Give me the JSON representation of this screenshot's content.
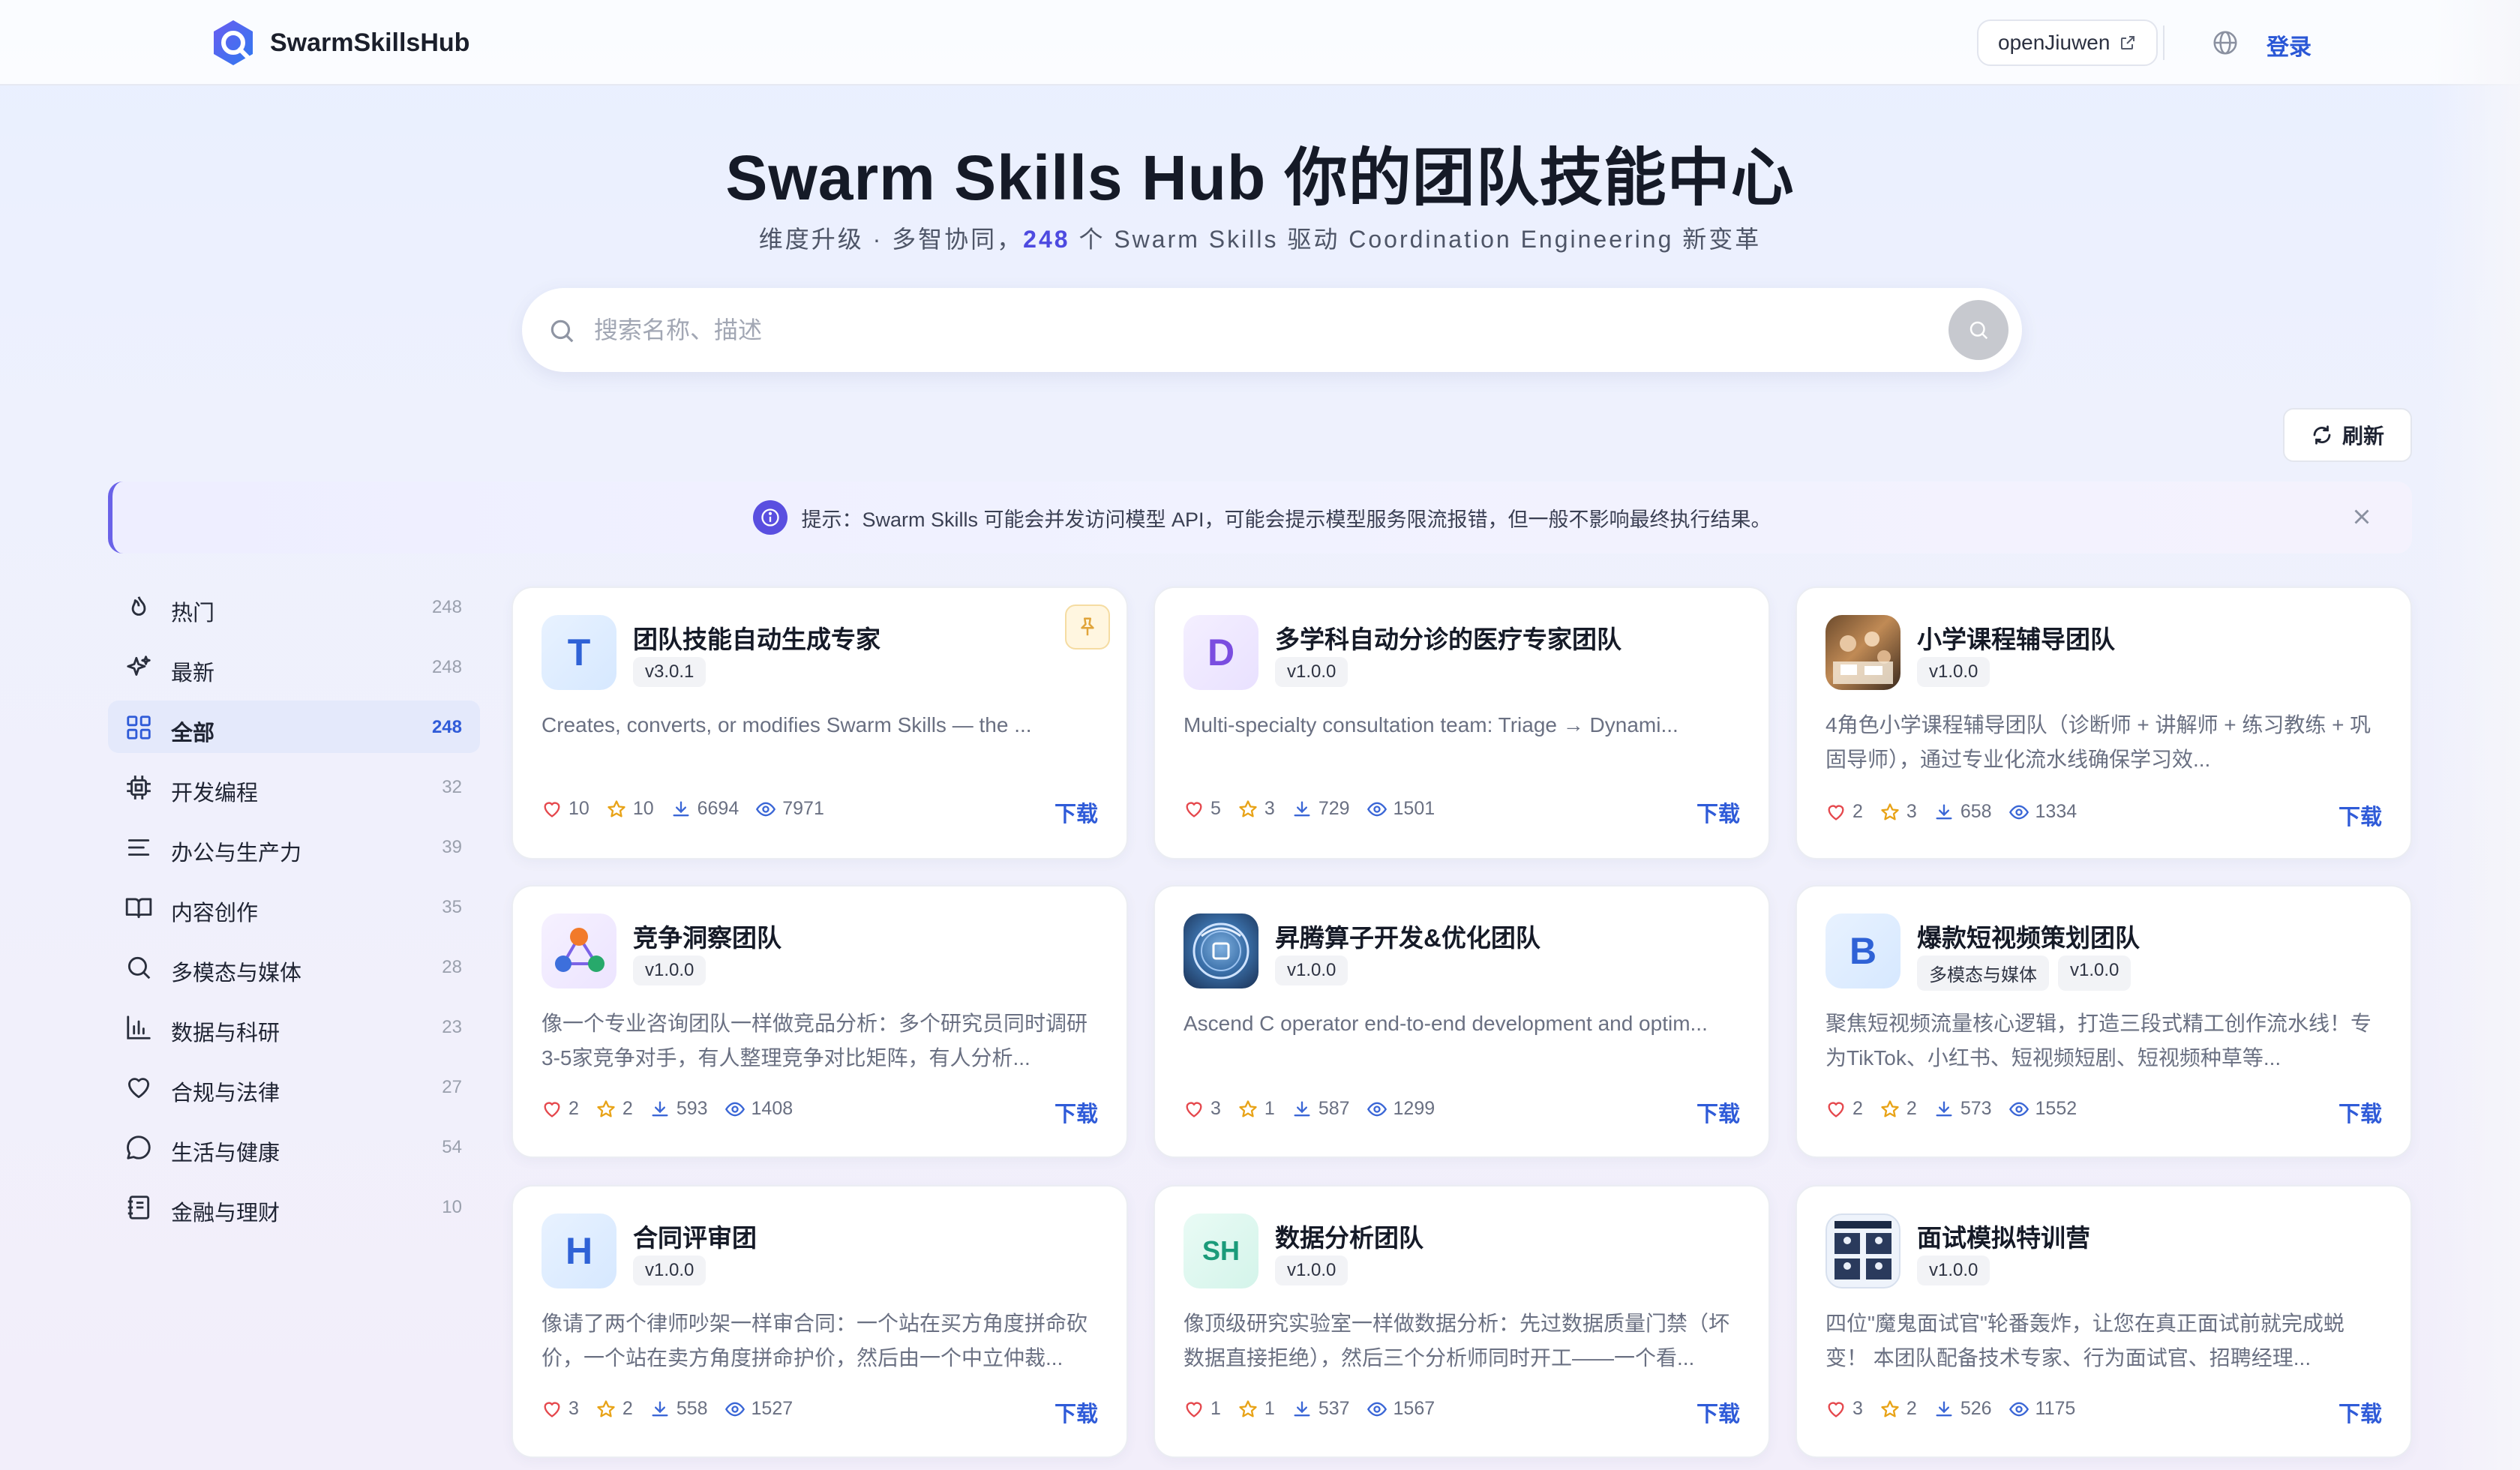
{
  "header": {
    "brand": "SwarmSkillsHub",
    "external_link": "openJiuwen",
    "login": "登录"
  },
  "hero": {
    "title": "Swarm Skills Hub 你的团队技能中心",
    "subtitle_prefix": "维度升级 · 多智协同，",
    "subtitle_count": "248",
    "subtitle_suffix": " 个 Swarm Skills 驱动 Coordination Engineering 新变革"
  },
  "search": {
    "placeholder": "搜索名称、描述"
  },
  "refresh_label": "刷新",
  "notice": {
    "text": "提示：Swarm Skills 可能会并发访问模型 API，可能会提示模型服务限流报错，但一般不影响最终执行结果。"
  },
  "sidebar": {
    "items": [
      {
        "label": "热门",
        "count": "248",
        "icon": "fire-icon"
      },
      {
        "label": "最新",
        "count": "248",
        "icon": "sparkle-icon"
      },
      {
        "label": "全部",
        "count": "248",
        "icon": "grid-icon",
        "active": true
      },
      {
        "label": "开发编程",
        "count": "32",
        "icon": "chip-icon"
      },
      {
        "label": "办公与生产力",
        "count": "39",
        "icon": "lines-icon"
      },
      {
        "label": "内容创作",
        "count": "35",
        "icon": "book-icon"
      },
      {
        "label": "多模态与媒体",
        "count": "28",
        "icon": "search-icon"
      },
      {
        "label": "数据与科研",
        "count": "23",
        "icon": "bar-chart-icon"
      },
      {
        "label": "合规与法律",
        "count": "27",
        "icon": "heart-icon"
      },
      {
        "label": "生活与健康",
        "count": "54",
        "icon": "chat-bubble-icon"
      },
      {
        "label": "金融与理财",
        "count": "10",
        "icon": "ledger-icon"
      }
    ]
  },
  "cards": [
    {
      "avatar": "T",
      "avatar_style": "blue",
      "title": "团队技能自动生成专家",
      "tags": [
        "v3.0.1"
      ],
      "desc": "Creates, converts, or modifies Swarm Skills — the ...",
      "likes": "10",
      "stars": "10",
      "downloads": "6694",
      "views": "7971",
      "pinned": true,
      "download_label": "下载"
    },
    {
      "avatar": "D",
      "avatar_style": "purple",
      "title": "多学科自动分诊的医疗专家团队",
      "tags": [
        "v1.0.0"
      ],
      "desc": "Multi-specialty consultation team: Triage → Dynami...",
      "likes": "5",
      "stars": "3",
      "downloads": "729",
      "views": "1501",
      "download_label": "下载"
    },
    {
      "avatar": "",
      "avatar_style": "photo-classroom",
      "title": "小学课程辅导团队",
      "tags": [
        "v1.0.0"
      ],
      "desc": "4角色小学课程辅导团队（诊断师 + 讲解师 + 练习教练 + 巩固导师），通过专业化流水线确保学习效...",
      "likes": "2",
      "stars": "3",
      "downloads": "658",
      "views": "1334",
      "download_label": "下载"
    },
    {
      "avatar": "",
      "avatar_style": "nodes",
      "title": "竞争洞察团队",
      "tags": [
        "v1.0.0"
      ],
      "desc": "像一个专业咨询团队一样做竞品分析：多个研究员同时调研3-5家竞争对手，有人整理竞争对比矩阵，有人分析...",
      "likes": "2",
      "stars": "2",
      "downloads": "593",
      "views": "1408",
      "download_label": "下载"
    },
    {
      "avatar": "",
      "avatar_style": "cann",
      "title": "昇腾算子开发&优化团队",
      "tags": [
        "v1.0.0"
      ],
      "desc": "Ascend C operator end-to-end development and optim...",
      "likes": "3",
      "stars": "1",
      "downloads": "587",
      "views": "1299",
      "download_label": "下载"
    },
    {
      "avatar": "B",
      "avatar_style": "blue",
      "title": "爆款短视频策划团队",
      "tags": [
        "多模态与媒体",
        "v1.0.0"
      ],
      "desc": "聚焦短视频流量核心逻辑，打造三段式精工创作流水线！专为TikTok、小红书、短视频短剧、短视频种草等...",
      "likes": "2",
      "stars": "2",
      "downloads": "573",
      "views": "1552",
      "download_label": "下载"
    },
    {
      "avatar": "H",
      "avatar_style": "blue",
      "title": "合同评审团",
      "tags": [
        "v1.0.0"
      ],
      "desc": "像请了两个律师吵架一样审合同：一个站在买方角度拼命砍价，一个站在卖方角度拼命护价，然后由一个中立仲裁...",
      "likes": "3",
      "stars": "2",
      "downloads": "558",
      "views": "1527",
      "download_label": "下载"
    },
    {
      "avatar": "SH",
      "avatar_style": "green",
      "title": "数据分析团队",
      "tags": [
        "v1.0.0"
      ],
      "desc": "像顶级研究实验室一样做数据分析：先过数据质量门禁（坏数据直接拒绝），然后三个分析师同时开工——一个看...",
      "likes": "1",
      "stars": "1",
      "downloads": "537",
      "views": "1567",
      "download_label": "下载"
    },
    {
      "avatar": "",
      "avatar_style": "photo-interview",
      "title": "面试模拟特训营",
      "tags": [
        "v1.0.0"
      ],
      "desc": "四位\"魔鬼面试官\"轮番轰炸，让您在真正面试前就完成蜕变！ 本团队配备技术专家、行为面试官、招聘经理...",
      "likes": "3",
      "stars": "2",
      "downloads": "526",
      "views": "1175",
      "download_label": "下载"
    }
  ]
}
